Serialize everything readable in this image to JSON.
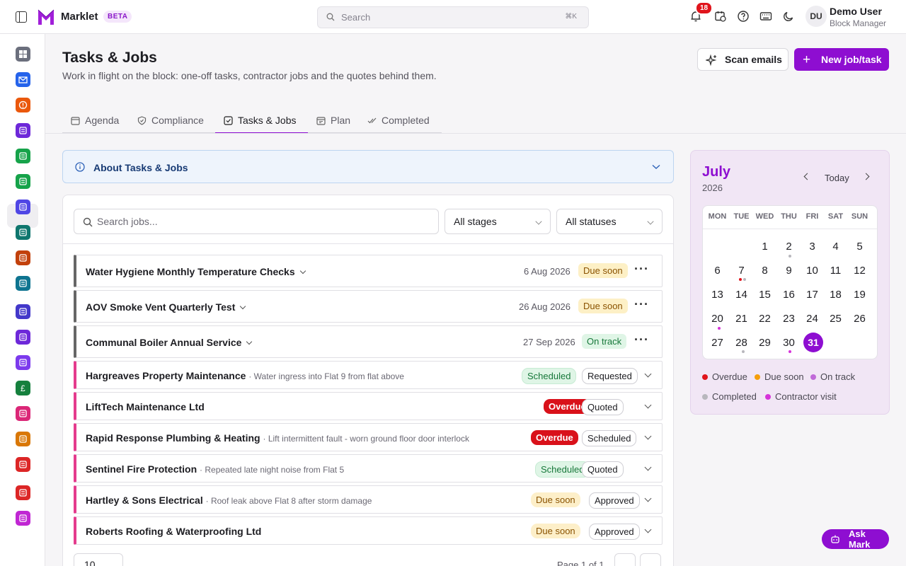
{
  "header": {
    "brand": "Marklet",
    "beta": "BETA",
    "search_placeholder": "Search",
    "search_shortcut": "⌘K",
    "notification_count": "18",
    "user_initials": "DU",
    "user_name": "Demo User",
    "user_role": "Block Manager"
  },
  "sidebar": {
    "items": [
      {
        "icon": "dashboard-icon",
        "color": "#6b6f7d"
      },
      {
        "icon": "mail-icon",
        "color": "#2563eb"
      },
      {
        "icon": "alert-icon",
        "color": "#ea580c"
      },
      {
        "icon": "inbox-icon",
        "color": "#6d28d9"
      },
      {
        "icon": "clipboard-icon",
        "color": "#16a34a"
      },
      {
        "icon": "checklist-icon",
        "color": "#16a34a"
      },
      {
        "icon": "folder-icon",
        "color": "#4f46e5"
      },
      {
        "icon": "ledger-icon",
        "color": "#0f766e"
      },
      {
        "icon": "building-icon",
        "color": "#c2410c"
      },
      {
        "icon": "chart-icon",
        "color": "#0e7490"
      },
      {
        "icon": "bank-icon",
        "color": "#4338ca"
      },
      {
        "icon": "people-icon",
        "color": "#6d28d9"
      },
      {
        "icon": "gavel-icon",
        "color": "#7c3aed"
      },
      {
        "icon": "pound-icon",
        "color": "#15803d"
      },
      {
        "icon": "contact-icon",
        "color": "#db2777"
      },
      {
        "icon": "wrench-icon",
        "color": "#d97706"
      },
      {
        "icon": "megaphone-icon",
        "color": "#dc2626"
      },
      {
        "icon": "book-icon",
        "color": "#dc2626"
      },
      {
        "icon": "sparkle-icon",
        "color": "#c026d3"
      }
    ]
  },
  "page": {
    "title": "Tasks & Jobs",
    "subtitle": "Work in flight on the block: one-off tasks, contractor jobs and the quotes behind them.",
    "scan_button": "Scan emails",
    "new_button": "New job/task"
  },
  "tabs": [
    {
      "label": "Agenda"
    },
    {
      "label": "Compliance"
    },
    {
      "label": "Tasks & Jobs"
    },
    {
      "label": "Plan"
    },
    {
      "label": "Completed"
    }
  ],
  "about": {
    "label": "About Tasks & Jobs"
  },
  "filters": {
    "search_placeholder": "Search jobs...",
    "stage": "All stages",
    "status": "All statuses"
  },
  "jobs": [
    {
      "title": "Water Hygiene Monthly Temperature Checks",
      "date": "6 Aug 2026",
      "status": "Due soon"
    },
    {
      "title": "AOV Smoke Vent Quarterly Test",
      "date": "26 Aug 2026",
      "status": "Due soon"
    },
    {
      "title": "Communal Boiler Annual Service",
      "date": "27 Sep 2026",
      "status": "On track"
    },
    {
      "title": "Hargreaves Property Maintenance",
      "desc": "· Water ingress into Flat 9 from flat above",
      "state": "Scheduled",
      "stage": "Requested"
    },
    {
      "title": "LiftTech Maintenance Ltd",
      "desc": "",
      "state": "Overdue",
      "stage": "Quoted"
    },
    {
      "title": "Rapid Response Plumbing & Heating",
      "desc": "· Lift intermittent fault - worn ground floor door interlock",
      "state": "Overdue",
      "stage": "Scheduled"
    },
    {
      "title": "Sentinel Fire Protection",
      "desc": "· Repeated late night noise from Flat 5",
      "state": "Scheduled",
      "stage": "Quoted"
    },
    {
      "title": "Hartley & Sons Electrical",
      "desc": "· Roof leak above Flat 8 after storm damage",
      "state": "Due soon",
      "stage": "Approved"
    },
    {
      "title": "Roberts Roofing & Waterproofing Ltd",
      "desc": "",
      "state": "Due soon",
      "stage": "Approved"
    }
  ],
  "pagination": {
    "page_size": "10",
    "info": "Page 1 of 1"
  },
  "calendar": {
    "month": "July",
    "year": "2026",
    "today": "Today",
    "weekdays": [
      "MON",
      "TUE",
      "WED",
      "THU",
      "FRI",
      "SAT",
      "SUN"
    ],
    "selected_day": "31",
    "legend": [
      "Overdue",
      "Due soon",
      "On track",
      "Completed",
      "Contractor visit"
    ],
    "legend_colors": [
      "#e0141c",
      "#f59e0b",
      "#c06ad8",
      "#b8b7bd",
      "#d633d9"
    ]
  },
  "ask": {
    "label": "Ask Mark"
  }
}
